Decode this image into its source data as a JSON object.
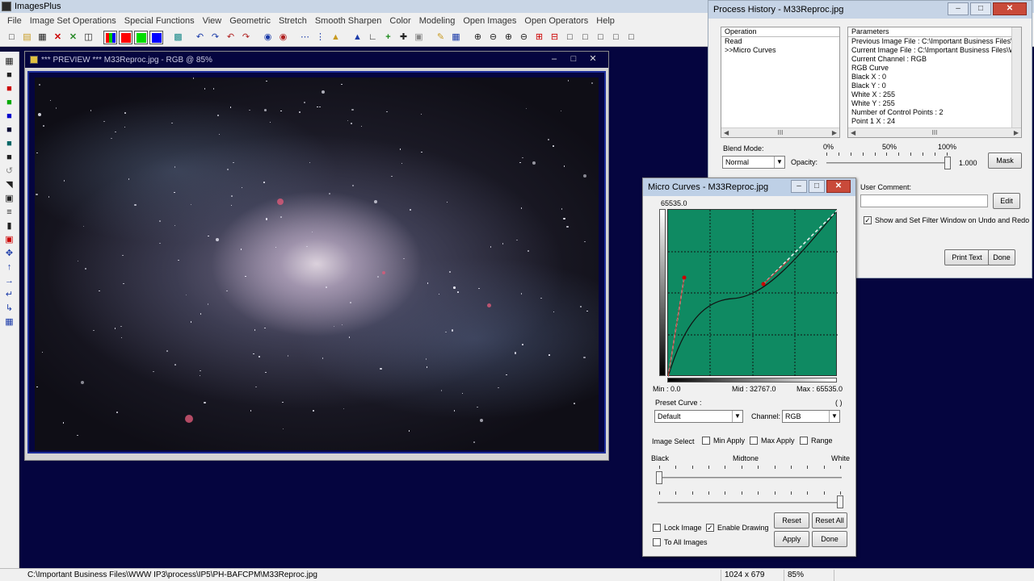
{
  "app": {
    "title": "ImagesPlus"
  },
  "menu": [
    "File",
    "Image Set Operations",
    "Special Functions",
    "View",
    "Geometric",
    "Stretch",
    "Smooth Sharpen",
    "Color",
    "Modeling",
    "Open Images",
    "Open Operators",
    "Help"
  ],
  "toolbar": {
    "icons": [
      "new-file-icon",
      "open-folder-icon",
      "save-icon",
      "close-x-icon",
      "close-all-icon",
      "copy-icon",
      "rgb-icon",
      "red-channel-icon",
      "green-channel-icon",
      "blue-channel-icon",
      "grid-icon",
      "undo-icon",
      "redo-icon",
      "undo-all-icon",
      "redo-all-icon",
      "record-icon",
      "record-stop-icon",
      "dots-icon",
      "points-icon",
      "open-image-icon",
      "triangle-icon",
      "corner-icon",
      "plus-icon",
      "crosshair-icon",
      "frame-icon",
      "pencil-icon",
      "table-icon",
      "zoom-in-icon",
      "zoom-out-icon",
      "zoom-fit-icon",
      "zoom-actual-icon",
      "add-box-icon",
      "remove-box-icon",
      "square-1-icon",
      "square-2-icon",
      "square-3-icon",
      "square-4-icon",
      "square-5-icon"
    ]
  },
  "preview": {
    "title": "*** PREVIEW *** M33Reproc.jpg - RGB @ 85%",
    "minimize": "–",
    "maximize": "□",
    "close": "✕"
  },
  "process_history": {
    "title": "Process History - M33Reproc.jpg",
    "operation_header": "Operation",
    "operations": [
      "Read",
      ">>Micro Curves"
    ],
    "parameters_header": "Parameters",
    "parameters": [
      "Previous Image File : C:\\Important Business Files\\WW",
      "Current Image File : C:\\Important Business Files\\WW",
      "Current Channel : RGB",
      "RGB Curve",
      " Black X : 0",
      " Black Y : 0",
      " White X : 255",
      " White Y : 255",
      " Number of Control Points : 2",
      "  Point 1 X : 24"
    ],
    "blend_mode_label": "Blend Mode:",
    "blend_mode": "Normal",
    "opacity_label": "Opacity:",
    "opacity_pct_0": "0%",
    "opacity_pct_50": "50%",
    "opacity_pct_100": "100%",
    "opacity_value": "1.000",
    "opacity_fraction": 1.0,
    "mask_label": "Mask",
    "user_comment_label": "User Comment:",
    "edit_label": "Edit",
    "show_filter_label": "Show and Set Filter Window on Undo and Redo",
    "show_filter_checked": true,
    "print_text_label": "Print Text",
    "done_label": "Done",
    "scroll_mid": "III"
  },
  "micro_curves": {
    "title": "Micro Curves - M33Reproc.jpg",
    "max_top": "65535.0",
    "min_label": "Min : 0.0",
    "mid_label": "Mid : 32767.0",
    "max_label": "Max : 65535.0",
    "preset_label": "Preset Curve :",
    "preset_value": "Default",
    "paren": "( )",
    "channel_label": "Channel:",
    "channel_value": "RGB",
    "image_select_label": "Image Select",
    "min_apply": "Min Apply",
    "max_apply": "Max Apply",
    "range_label": "Range",
    "black_label": "Black",
    "midtone_label": "Midtone",
    "white_label": "White",
    "lock_image": "Lock Image",
    "enable_drawing": "Enable Drawing",
    "enable_drawing_checked": true,
    "to_all_images": "To All Images",
    "reset_label": "Reset",
    "reset_all_label": "Reset All",
    "apply_label": "Apply",
    "done_label": "Done",
    "control_points": [
      [
        24,
        183
      ],
      [
        180,
        148
      ]
    ]
  },
  "colors": {
    "workspace": "#05053f",
    "graph": "#0f8a62",
    "title_bar": "#c6d4e6"
  },
  "statusbar": {
    "path": "C:\\Important Business Files\\WWW IP3\\process\\IP5\\PH-BAFCPM\\M33Reproc.jpg",
    "dimensions": "1024 x 679",
    "zoom": "85%"
  }
}
